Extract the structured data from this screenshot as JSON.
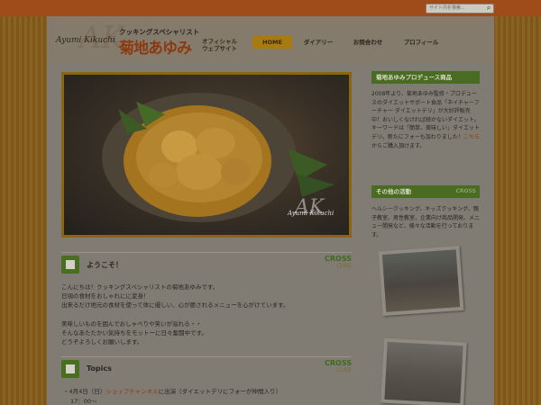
{
  "search": {
    "placeholder": "サイト内を検索..."
  },
  "logo": {
    "name": "Ayumi Kikuchi",
    "monogram": "AK"
  },
  "header": {
    "subtitle": "クッキングスペシャリスト",
    "title": "菊地あゆみ",
    "title_sub": [
      "オフィシャル",
      "ウェブサイト"
    ]
  },
  "nav": {
    "items": [
      "HOME",
      "ダイアリー",
      "お問合わせ",
      "プロフィール"
    ],
    "active": "HOME"
  },
  "main_photo": {
    "signature": "Ayumi Kikuchi",
    "monogram": "AK"
  },
  "welcome": {
    "title": "ようこそ！",
    "badge": "CROSS",
    "badge_sub": "CUBE",
    "paragraphs": [
      [
        "こんにちは！クッキングスペシャリストの菊地あゆみです。",
        "日頃の食材をおしゃれにに変身！",
        "出来るだけ地元の食材を使って体に優しい、心が癒されるメニューを心がけています。"
      ],
      [
        "美味しいものを囲んでおしゃべりや笑いが溢れる・・",
        "そんなあたたかい気持ちをモットーに日々奮闘中です。",
        "どうぞよろしくお願いします。"
      ]
    ]
  },
  "topics": {
    "title": "Topics",
    "badge": "CROSS",
    "badge_sub": "CUBE",
    "item_prefix": "・4月4日（日）",
    "item_link": "ショップチャンネル",
    "item_suffix": "に出演（ダイエットデリにフォーが仲間入り）",
    "item_time": "17：00〜"
  },
  "sidebar": {
    "box1": {
      "title": "菊地あゆみプロデュース商品",
      "text": "2008年より、菊地あゆみ監修・プロデュースのダイエットサポート食品「ネイチャーフーチャー ダイエットデリ」が大好評販売中！おいしくなければ続かないダイエット。キーワードは「簡単、美味しい」ダイエットデリ。新たにフォーも加わりました！",
      "link": "こちら",
      "link_suffix": "からご購入頂けます。"
    },
    "box2": {
      "title": "その他の活動",
      "badge": "CROSS",
      "text": "ヘルシークッキング、キッズクッキング、親子教室、男性教室、企業向け商品開発、メニュー開発など、様々な活動を行っております。"
    }
  },
  "colors": {
    "accent": "#a04c1a",
    "nav_active": "#a87a12",
    "side_head": "#4a6b22"
  }
}
